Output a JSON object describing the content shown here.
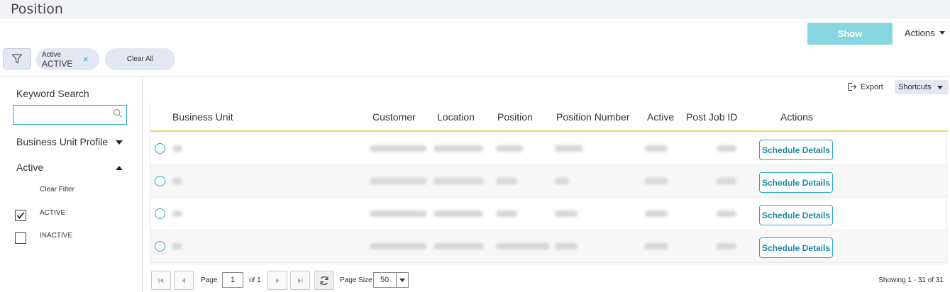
{
  "header": {
    "title": "Position"
  },
  "toolbar": {
    "show_label": "Show",
    "actions_label": "Actions"
  },
  "filter_chips": {
    "chip_label": "Active",
    "chip_value": "ACTIVE",
    "chip_close": "×",
    "clear_all_label": "Clear All"
  },
  "sidebar": {
    "keyword_label": "Keyword Search",
    "keyword_value": "",
    "business_unit_profile_label": "Business Unit Profile",
    "active_label": "Active",
    "clear_filter_label": "Clear Filter",
    "options": [
      {
        "label": "ACTIVE",
        "checked": true
      },
      {
        "label": "INACTIVE",
        "checked": false
      }
    ]
  },
  "grid_toolbar": {
    "export_label": "Export",
    "shortcuts_label": "Shortcuts"
  },
  "grid": {
    "columns": [
      "Business Unit",
      "Customer",
      "Location",
      "Position",
      "Position Number",
      "Active",
      "Post Job ID",
      "Actions"
    ],
    "rows": [
      {
        "action_label": "Schedule Details"
      },
      {
        "action_label": "Schedule Details"
      },
      {
        "action_label": "Schedule Details"
      },
      {
        "action_label": "Schedule Details"
      }
    ]
  },
  "pager": {
    "page_label": "Page",
    "page_value": "1",
    "of_label": "of 1",
    "page_size_label": "Page Size",
    "page_size_value": "50",
    "showing_text": "Showing 1 - 31 of 31"
  },
  "colors": {
    "accent": "#27a8c4",
    "show_button": "#86d6e2",
    "chip_bg": "#e3e7f4",
    "header_underline": "#f5d26a"
  }
}
